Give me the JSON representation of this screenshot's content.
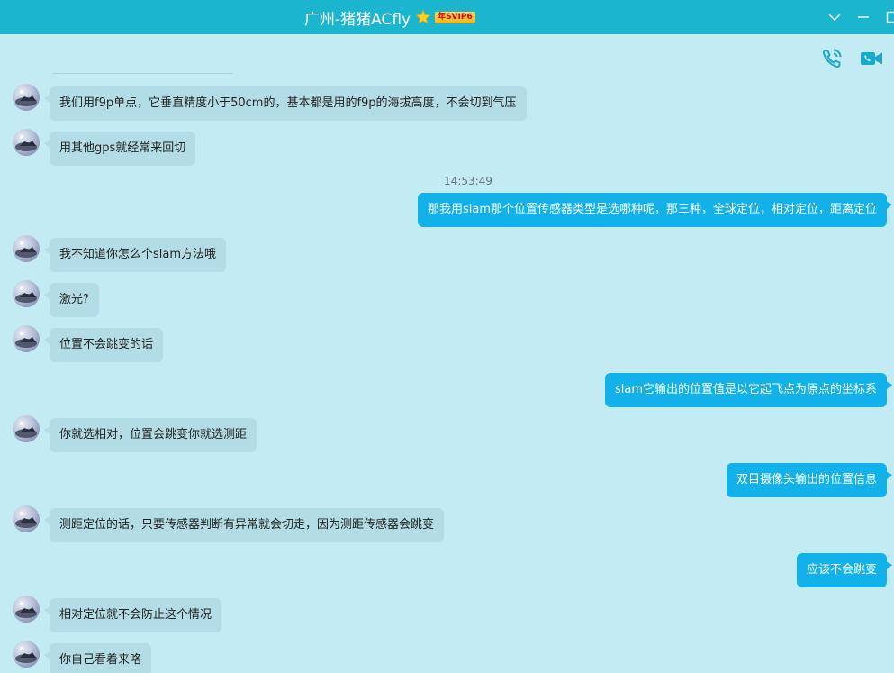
{
  "window": {
    "title": "广州-猪猪ACfly",
    "vip_badge": "年SVIP6",
    "icons": [
      "star-icon",
      "chevron-down-icon",
      "minimize-icon",
      "maximize-icon"
    ],
    "accent_color": "#1cb5cf"
  },
  "toolbar": {
    "icons": [
      "voice-call-icon",
      "video-call-icon"
    ]
  },
  "timestamp": "14:53:49",
  "messages": [
    {
      "side": "in",
      "text": "我们用f9p单点，它垂直精度小于50cm的，基本都是用的f9p的海拔高度，不会切到气压"
    },
    {
      "side": "in",
      "text": "用其他gps就经常来回切"
    },
    {
      "side": "out",
      "text": "那我用slam那个位置传感器类型是选哪种呢，那三种，全球定位，相对定位，距离定位"
    },
    {
      "side": "in",
      "text": "我不知道你怎么个slam方法哦"
    },
    {
      "side": "in",
      "text": "激光?"
    },
    {
      "side": "in",
      "text": "位置不会跳变的话"
    },
    {
      "side": "out",
      "text": "slam它输出的位置值是以它起飞点为原点的坐标系"
    },
    {
      "side": "in",
      "text": "你就选相对，位置会跳变你就选测距"
    },
    {
      "side": "out",
      "text": "双目摄像头输出的位置信息"
    },
    {
      "side": "in",
      "text": "测距定位的话，只要传感器判断有异常就会切走，因为测距传感器会跳变"
    },
    {
      "side": "out",
      "text": "应该不会跳变"
    },
    {
      "side": "in",
      "text": "相对定位就不会防止这个情况"
    },
    {
      "side": "in",
      "text": "你自己看着来咯"
    }
  ]
}
